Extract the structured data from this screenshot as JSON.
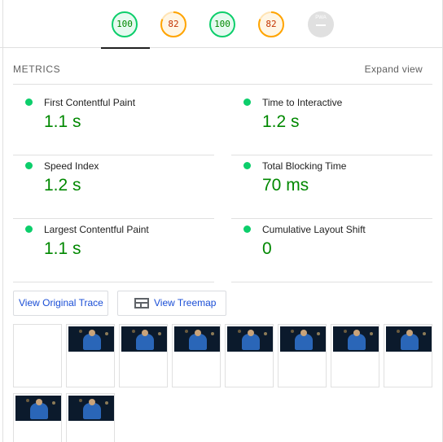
{
  "scores": [
    {
      "value": "100",
      "status": "pass",
      "fraction": 1.0
    },
    {
      "value": "82",
      "status": "average",
      "fraction": 0.82
    },
    {
      "value": "100",
      "status": "pass",
      "fraction": 1.0
    },
    {
      "value": "82",
      "status": "average",
      "fraction": 0.82
    },
    {
      "value": "PWA",
      "status": "na"
    }
  ],
  "colors": {
    "pass": "#0cce6b",
    "pass_text": "#008800",
    "average": "#ffa400",
    "average_text": "#c33300",
    "na": "#e0e0e0",
    "link": "#1a4ed6"
  },
  "metrics_section": {
    "title": "METRICS",
    "expand_label": "Expand view"
  },
  "metrics": [
    {
      "label": "First Contentful Paint",
      "value": "1.1 s",
      "status": "pass"
    },
    {
      "label": "Time to Interactive",
      "value": "1.2 s",
      "status": "pass"
    },
    {
      "label": "Speed Index",
      "value": "1.2 s",
      "status": "pass"
    },
    {
      "label": "Total Blocking Time",
      "value": "70 ms",
      "status": "pass"
    },
    {
      "label": "Largest Contentful Paint",
      "value": "1.1 s",
      "status": "pass"
    },
    {
      "label": "Cumulative Layout Shift",
      "value": "0",
      "status": "pass"
    }
  ],
  "buttons": {
    "view_trace": "View Original Trace",
    "view_treemap": "View Treemap",
    "treemap_icon": "treemap-icon"
  },
  "filmstrip": [
    {
      "blank": true
    },
    {
      "blank": false
    },
    {
      "blank": false
    },
    {
      "blank": false
    },
    {
      "blank": false
    },
    {
      "blank": false
    },
    {
      "blank": false
    },
    {
      "blank": false
    },
    {
      "blank": false
    },
    {
      "blank": false
    }
  ]
}
